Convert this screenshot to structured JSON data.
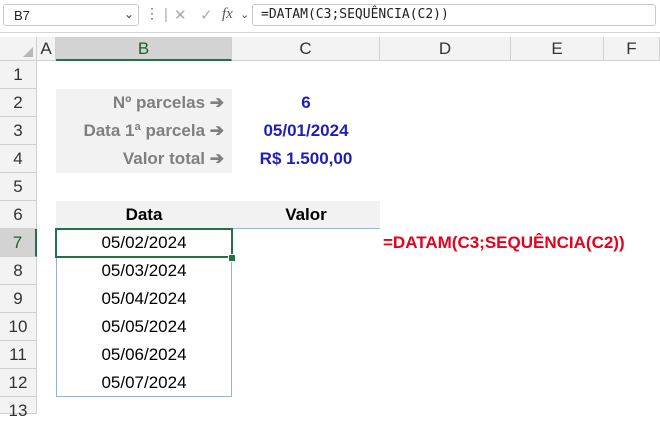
{
  "formula_bar": {
    "name_box": "B7",
    "formula": "=DATAM(C3;SEQUÊNCIA(C2))"
  },
  "columns": [
    "A",
    "B",
    "C",
    "D",
    "E",
    "F"
  ],
  "selected_column": "B",
  "rows": [
    "1",
    "2",
    "3",
    "4",
    "5",
    "6",
    "7",
    "8",
    "9",
    "10",
    "11",
    "12",
    "13"
  ],
  "selected_row": "7",
  "params": [
    {
      "label": "Nº parcelas ➔",
      "value": "6"
    },
    {
      "label": "Data 1ª parcela ➔",
      "value": "05/01/2024"
    },
    {
      "label": "Valor total ➔",
      "value": "R$ 1.500,00"
    }
  ],
  "table": {
    "headers": [
      "Data",
      "Valor"
    ],
    "dates": [
      "05/02/2024",
      "05/03/2024",
      "05/04/2024",
      "05/05/2024",
      "05/06/2024",
      "05/07/2024"
    ]
  },
  "note": "=DATAM(C3;SEQUÊNCIA(C2))",
  "colors": {
    "accent": "#217346",
    "value_blue": "#1f1fb8",
    "note_red": "#e8001c"
  }
}
